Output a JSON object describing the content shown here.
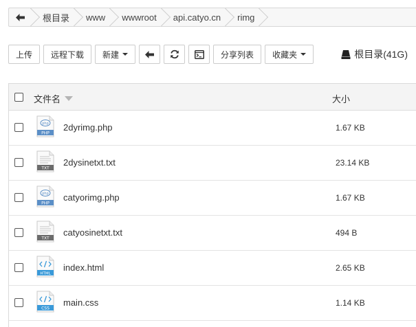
{
  "breadcrumb": {
    "items": [
      "根目录",
      "www",
      "wwwroot",
      "api.catyo.cn",
      "rimg"
    ]
  },
  "toolbar": {
    "upload": "上传",
    "remote_download": "远程下载",
    "new": "新建",
    "share_list": "分享列表",
    "favorites": "收藏夹",
    "disk_label": "根目录(41G)"
  },
  "table": {
    "col_name": "文件名",
    "col_size": "大小",
    "rows": [
      {
        "name": "2dyrimg.php",
        "size": "1.67 KB",
        "type": "PHP"
      },
      {
        "name": "2dysinetxt.txt",
        "size": "23.14 KB",
        "type": "TXT"
      },
      {
        "name": "catyorimg.php",
        "size": "1.67 KB",
        "type": "PHP"
      },
      {
        "name": "catyosinetxt.txt",
        "size": "494 B",
        "type": "TXT"
      },
      {
        "name": "index.html",
        "size": "2.65 KB",
        "type": "HTML"
      },
      {
        "name": "main.css",
        "size": "1.14 KB",
        "type": "CSS"
      }
    ]
  },
  "colors": {
    "php_badge": "#5b8fc7",
    "txt_badge": "#6b6b6b",
    "html_badge": "#3a9ad9",
    "css_badge": "#3a9ad9"
  }
}
